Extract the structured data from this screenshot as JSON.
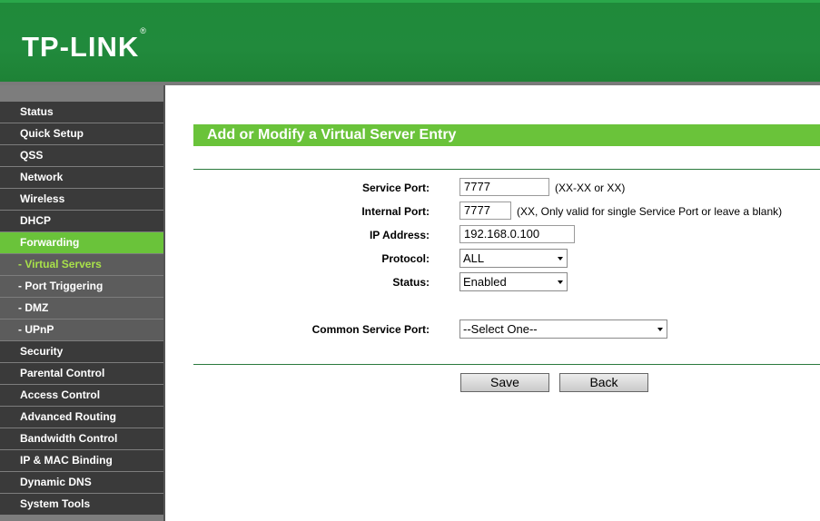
{
  "brand": {
    "logo": "TP-LINK",
    "reg": "®"
  },
  "sidebar": {
    "items": [
      {
        "label": "Status"
      },
      {
        "label": "Quick Setup"
      },
      {
        "label": "QSS"
      },
      {
        "label": "Network"
      },
      {
        "label": "Wireless"
      },
      {
        "label": "DHCP"
      },
      {
        "label": "Forwarding"
      },
      {
        "label": "- Virtual Servers"
      },
      {
        "label": "- Port Triggering"
      },
      {
        "label": "- DMZ"
      },
      {
        "label": "- UPnP"
      },
      {
        "label": "Security"
      },
      {
        "label": "Parental Control"
      },
      {
        "label": "Access Control"
      },
      {
        "label": "Advanced Routing"
      },
      {
        "label": "Bandwidth Control"
      },
      {
        "label": "IP & MAC Binding"
      },
      {
        "label": "Dynamic DNS"
      },
      {
        "label": "System Tools"
      }
    ]
  },
  "content": {
    "title": "Add or Modify a Virtual Server Entry",
    "service_port_label": "Service Port:",
    "service_port_value": "7777",
    "service_port_hint": "(XX-XX or XX)",
    "internal_port_label": "Internal Port:",
    "internal_port_value": "7777",
    "internal_port_hint": "(XX, Only valid for single Service Port or leave a blank)",
    "ip_label": "IP Address:",
    "ip_value": "192.168.0.100",
    "protocol_label": "Protocol:",
    "protocol_value": "ALL",
    "status_label": "Status:",
    "status_value": "Enabled",
    "common_port_label": "Common Service Port:",
    "common_port_value": "--Select One--",
    "save_label": "Save",
    "back_label": "Back"
  },
  "colors": {
    "header_green": "#1f8a3a",
    "accent_green": "#6ac33a",
    "menu_dark": "#3a3a3a"
  }
}
